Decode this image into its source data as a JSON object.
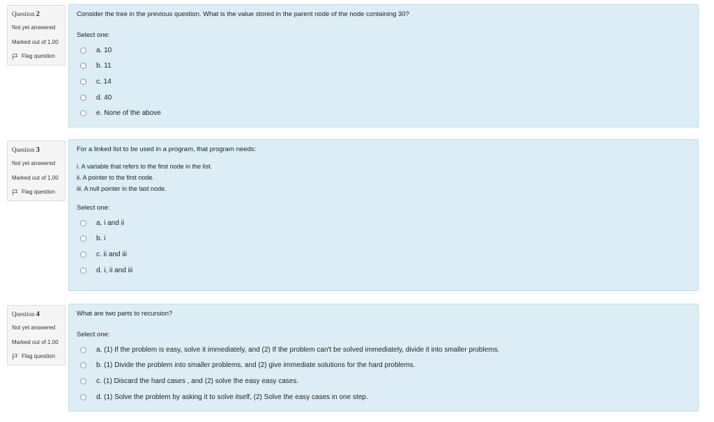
{
  "questions": [
    {
      "label": "Question",
      "number": "2",
      "state": "Not yet answered",
      "grade": "Marked out of 1.00",
      "flag_label": "Flag question",
      "text": "Consider the tree in the previous question. What is the value stored in the parent node of the node containing 30?",
      "sublines": [],
      "prompt": "Select one:",
      "options": [
        "a. 10",
        "b. 11",
        "c. 14",
        "d. 40",
        "e. None of the above"
      ]
    },
    {
      "label": "Question",
      "number": "3",
      "state": "Not yet answered",
      "grade": "Marked out of 1.00",
      "flag_label": "Flag question",
      "text": "For a linked list to be used in a program, that program needs:",
      "sublines": [
        "i. A variable that refers to the first node in the list.",
        "ii. A pointer to the first node.",
        "iii. A null pointer in the last node."
      ],
      "prompt": "Select one:",
      "options": [
        "a. i and ii",
        "b. i",
        "c. ii and iii",
        "d. i, ii and iii"
      ]
    },
    {
      "label": "Question",
      "number": "4",
      "state": "Not yet answered",
      "grade": "Marked out of 1.00",
      "flag_label": "Flag question",
      "text": "What are two parts to recursion?",
      "sublines": [],
      "prompt": "Select one:",
      "options": [
        "a. (1) If the problem is easy, solve it immediately, and (2) If the problem can't be solved immediately, divide it into smaller problems.",
        "b. (1) Divide the problem into smaller problems, and (2) give immediate solutions for the hard problems.",
        "c. (1) Discard the hard cases , and (2) solve the easy easy cases.",
        "d. (1) Solve the problem by asking it to solve itself, (2) Solve the easy cases in one step."
      ]
    }
  ]
}
